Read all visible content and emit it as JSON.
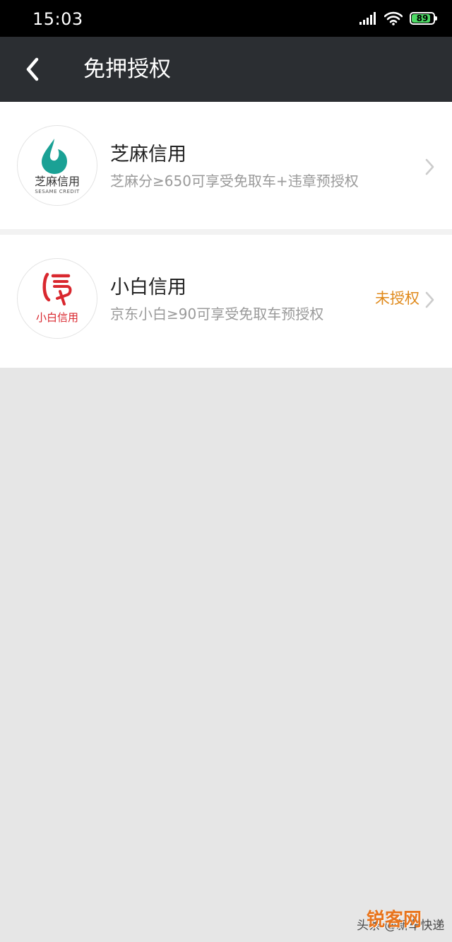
{
  "status_bar": {
    "time": "15:03",
    "battery": "89",
    "battery_color": "#4cd964"
  },
  "nav": {
    "back_icon": "chevron-left-icon",
    "title": "免押授权"
  },
  "items": [
    {
      "title": "芝麻信用",
      "description": "芝麻分≥650可享受免取车+违章预授权",
      "status": "",
      "logo": {
        "name": "芝麻信用",
        "subtitle": "SESAME CREDIT",
        "icon": "sesame-credit-logo-icon",
        "color": "#1aa195"
      }
    },
    {
      "title": "小白信用",
      "description": "京东小白≥90可享受免取车预授权",
      "status": "未授权",
      "logo": {
        "name": "小白信用",
        "icon": "xiaobai-credit-logo-icon",
        "color": "#d9272e"
      }
    }
  ],
  "watermark": {
    "text": "头条 @新车快递",
    "logo_text": "锐客网"
  },
  "colors": {
    "nav_background": "#2b2e32",
    "status_orange": "#e08a1c",
    "page_background": "#e6e6e6"
  }
}
